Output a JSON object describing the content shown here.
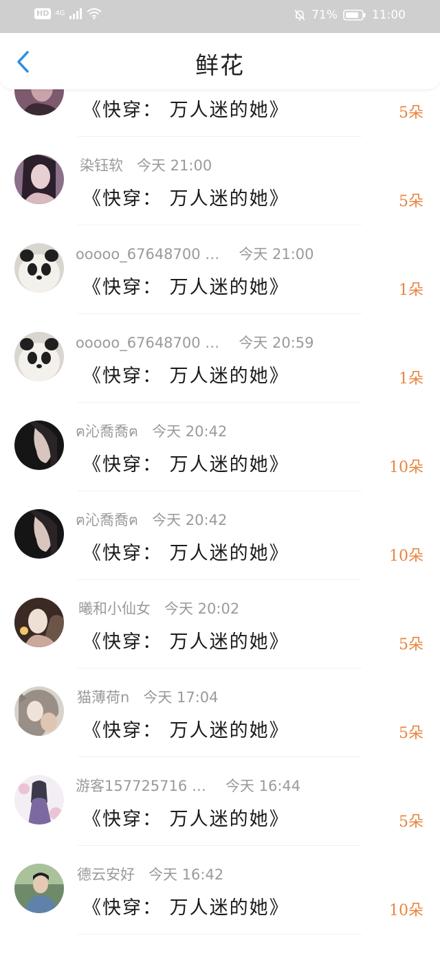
{
  "status_bar": {
    "hd": "HD",
    "network": "4G",
    "battery_percent": "71%",
    "time": "11:00"
  },
  "header": {
    "title": "鲜花",
    "back_icon": "chevron-left-icon"
  },
  "colors": {
    "accent": "#2f8fe0",
    "count": "#e8843d",
    "meta": "#9a9a9a"
  },
  "rows": [
    {
      "user": "",
      "time": "",
      "book": "《快穿： 万人迷的她》",
      "count": "5朵"
    },
    {
      "user": "染钰软",
      "time": "今天 21:00",
      "book": "《快穿： 万人迷的她》",
      "count": "5朵"
    },
    {
      "user": "ooooo_67648700 …",
      "time": "今天 21:00",
      "book": "《快穿： 万人迷的她》",
      "count": "1朵"
    },
    {
      "user": "ooooo_67648700 …",
      "time": "今天 20:59",
      "book": "《快穿： 万人迷的她》",
      "count": "1朵"
    },
    {
      "user": "ฅ沁喬喬ฅ",
      "time": "今天 20:42",
      "book": "《快穿： 万人迷的她》",
      "count": "10朵"
    },
    {
      "user": "ฅ沁喬喬ฅ",
      "time": "今天 20:42",
      "book": "《快穿： 万人迷的她》",
      "count": "10朵"
    },
    {
      "user": "曦和小仙女",
      "time": "今天 20:02",
      "book": "《快穿： 万人迷的她》",
      "count": "5朵"
    },
    {
      "user": "猫薄荷n",
      "time": "今天 17:04",
      "book": "《快穿： 万人迷的她》",
      "count": "5朵"
    },
    {
      "user": "游客157725716 …",
      "time": "今天 16:44",
      "book": "《快穿： 万人迷的她》",
      "count": "5朵"
    },
    {
      "user": "德云安好",
      "time": "今天 16:42",
      "book": "《快穿： 万人迷的她》",
      "count": "10朵"
    }
  ]
}
